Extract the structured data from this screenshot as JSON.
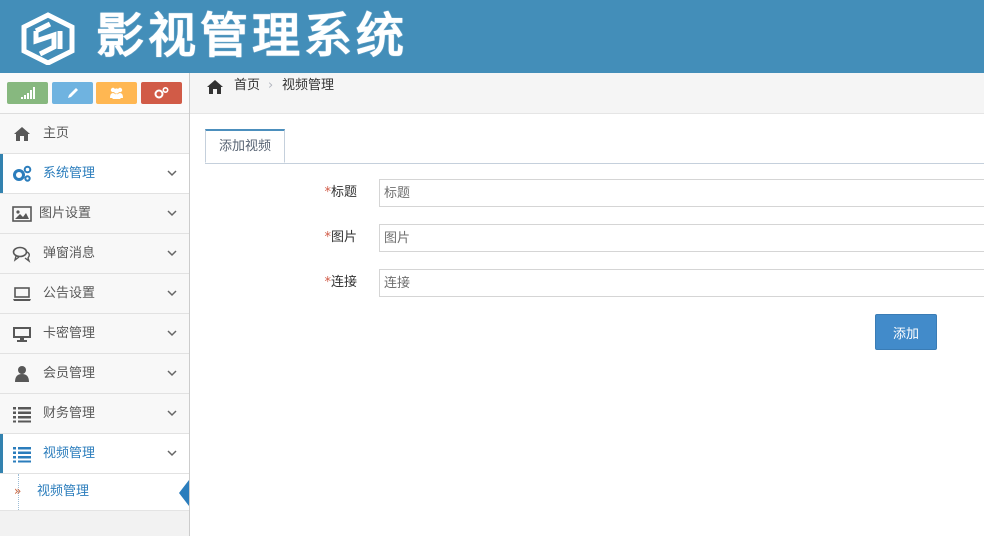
{
  "header": {
    "app_title": "影视管理系统"
  },
  "colors": {
    "header_bg": "#438eb9",
    "shortcut_green": "#87b87f",
    "shortcut_blue": "#6fb3e0",
    "shortcut_orange": "#ffb752",
    "shortcut_red": "#d15b47",
    "primary": "#428bca"
  },
  "shortcuts": [
    {
      "icon": "signal-icon"
    },
    {
      "icon": "pencil-icon"
    },
    {
      "icon": "users-icon"
    },
    {
      "icon": "cogs-icon"
    }
  ],
  "sidebar": {
    "items": [
      {
        "label": "主页",
        "icon": "home-icon"
      },
      {
        "label": "系统管理",
        "icon": "cogs-icon"
      },
      {
        "label": "图片设置",
        "icon": "picture-icon"
      },
      {
        "label": "弹窗消息",
        "icon": "comments-icon"
      },
      {
        "label": "公告设置",
        "icon": "laptop-icon"
      },
      {
        "label": "卡密管理",
        "icon": "desktop-icon"
      },
      {
        "label": "会员管理",
        "icon": "user-icon"
      },
      {
        "label": "财务管理",
        "icon": "list-icon"
      },
      {
        "label": "视频管理",
        "icon": "list-icon"
      }
    ],
    "sub_item": {
      "label": "视频管理"
    }
  },
  "breadcrumb": {
    "home": "首页",
    "current": "视频管理"
  },
  "tab": {
    "label": "添加视频"
  },
  "form": {
    "fields": [
      {
        "required_mark": "*",
        "label": "标题",
        "placeholder": "标题"
      },
      {
        "required_mark": "*",
        "label": "图片",
        "placeholder": "图片"
      },
      {
        "required_mark": "*",
        "label": "连接",
        "placeholder": "连接"
      }
    ],
    "submit_label": "添加"
  }
}
